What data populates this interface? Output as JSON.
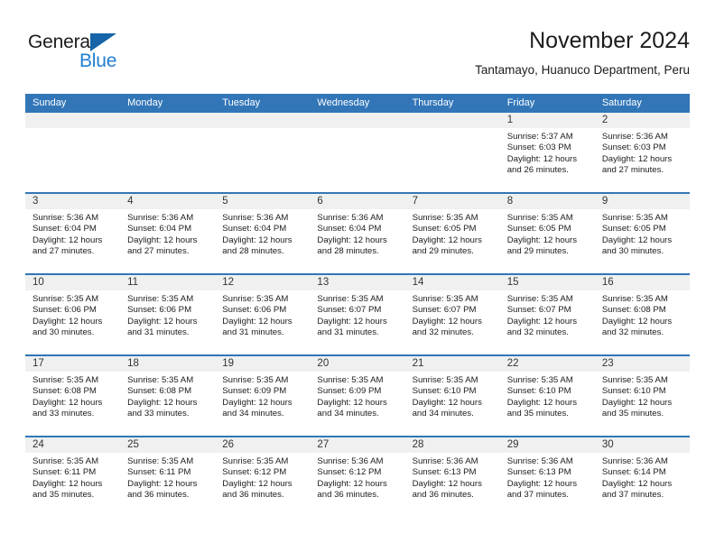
{
  "brand": {
    "word_one": "General",
    "word_two": "Blue",
    "accent_color": "#1f7fd1",
    "triangle_color": "#1565a8",
    "triangle_icon": "triangle-icon"
  },
  "header": {
    "title": "November 2024",
    "subtitle": "Tantamayo, Huanuco Department, Peru"
  },
  "calendar": {
    "header_bg": "#3276b8",
    "weekdays": [
      "Sunday",
      "Monday",
      "Tuesday",
      "Wednesday",
      "Thursday",
      "Friday",
      "Saturday"
    ],
    "weeks": [
      [
        {
          "day": "",
          "sunrise": "",
          "sunset": "",
          "daylight": ""
        },
        {
          "day": "",
          "sunrise": "",
          "sunset": "",
          "daylight": ""
        },
        {
          "day": "",
          "sunrise": "",
          "sunset": "",
          "daylight": ""
        },
        {
          "day": "",
          "sunrise": "",
          "sunset": "",
          "daylight": ""
        },
        {
          "day": "",
          "sunrise": "",
          "sunset": "",
          "daylight": ""
        },
        {
          "day": "1",
          "sunrise": "Sunrise: 5:37 AM",
          "sunset": "Sunset: 6:03 PM",
          "daylight": "Daylight: 12 hours and 26 minutes."
        },
        {
          "day": "2",
          "sunrise": "Sunrise: 5:36 AM",
          "sunset": "Sunset: 6:03 PM",
          "daylight": "Daylight: 12 hours and 27 minutes."
        }
      ],
      [
        {
          "day": "3",
          "sunrise": "Sunrise: 5:36 AM",
          "sunset": "Sunset: 6:04 PM",
          "daylight": "Daylight: 12 hours and 27 minutes."
        },
        {
          "day": "4",
          "sunrise": "Sunrise: 5:36 AM",
          "sunset": "Sunset: 6:04 PM",
          "daylight": "Daylight: 12 hours and 27 minutes."
        },
        {
          "day": "5",
          "sunrise": "Sunrise: 5:36 AM",
          "sunset": "Sunset: 6:04 PM",
          "daylight": "Daylight: 12 hours and 28 minutes."
        },
        {
          "day": "6",
          "sunrise": "Sunrise: 5:36 AM",
          "sunset": "Sunset: 6:04 PM",
          "daylight": "Daylight: 12 hours and 28 minutes."
        },
        {
          "day": "7",
          "sunrise": "Sunrise: 5:35 AM",
          "sunset": "Sunset: 6:05 PM",
          "daylight": "Daylight: 12 hours and 29 minutes."
        },
        {
          "day": "8",
          "sunrise": "Sunrise: 5:35 AM",
          "sunset": "Sunset: 6:05 PM",
          "daylight": "Daylight: 12 hours and 29 minutes."
        },
        {
          "day": "9",
          "sunrise": "Sunrise: 5:35 AM",
          "sunset": "Sunset: 6:05 PM",
          "daylight": "Daylight: 12 hours and 30 minutes."
        }
      ],
      [
        {
          "day": "10",
          "sunrise": "Sunrise: 5:35 AM",
          "sunset": "Sunset: 6:06 PM",
          "daylight": "Daylight: 12 hours and 30 minutes."
        },
        {
          "day": "11",
          "sunrise": "Sunrise: 5:35 AM",
          "sunset": "Sunset: 6:06 PM",
          "daylight": "Daylight: 12 hours and 31 minutes."
        },
        {
          "day": "12",
          "sunrise": "Sunrise: 5:35 AM",
          "sunset": "Sunset: 6:06 PM",
          "daylight": "Daylight: 12 hours and 31 minutes."
        },
        {
          "day": "13",
          "sunrise": "Sunrise: 5:35 AM",
          "sunset": "Sunset: 6:07 PM",
          "daylight": "Daylight: 12 hours and 31 minutes."
        },
        {
          "day": "14",
          "sunrise": "Sunrise: 5:35 AM",
          "sunset": "Sunset: 6:07 PM",
          "daylight": "Daylight: 12 hours and 32 minutes."
        },
        {
          "day": "15",
          "sunrise": "Sunrise: 5:35 AM",
          "sunset": "Sunset: 6:07 PM",
          "daylight": "Daylight: 12 hours and 32 minutes."
        },
        {
          "day": "16",
          "sunrise": "Sunrise: 5:35 AM",
          "sunset": "Sunset: 6:08 PM",
          "daylight": "Daylight: 12 hours and 32 minutes."
        }
      ],
      [
        {
          "day": "17",
          "sunrise": "Sunrise: 5:35 AM",
          "sunset": "Sunset: 6:08 PM",
          "daylight": "Daylight: 12 hours and 33 minutes."
        },
        {
          "day": "18",
          "sunrise": "Sunrise: 5:35 AM",
          "sunset": "Sunset: 6:08 PM",
          "daylight": "Daylight: 12 hours and 33 minutes."
        },
        {
          "day": "19",
          "sunrise": "Sunrise: 5:35 AM",
          "sunset": "Sunset: 6:09 PM",
          "daylight": "Daylight: 12 hours and 34 minutes."
        },
        {
          "day": "20",
          "sunrise": "Sunrise: 5:35 AM",
          "sunset": "Sunset: 6:09 PM",
          "daylight": "Daylight: 12 hours and 34 minutes."
        },
        {
          "day": "21",
          "sunrise": "Sunrise: 5:35 AM",
          "sunset": "Sunset: 6:10 PM",
          "daylight": "Daylight: 12 hours and 34 minutes."
        },
        {
          "day": "22",
          "sunrise": "Sunrise: 5:35 AM",
          "sunset": "Sunset: 6:10 PM",
          "daylight": "Daylight: 12 hours and 35 minutes."
        },
        {
          "day": "23",
          "sunrise": "Sunrise: 5:35 AM",
          "sunset": "Sunset: 6:10 PM",
          "daylight": "Daylight: 12 hours and 35 minutes."
        }
      ],
      [
        {
          "day": "24",
          "sunrise": "Sunrise: 5:35 AM",
          "sunset": "Sunset: 6:11 PM",
          "daylight": "Daylight: 12 hours and 35 minutes."
        },
        {
          "day": "25",
          "sunrise": "Sunrise: 5:35 AM",
          "sunset": "Sunset: 6:11 PM",
          "daylight": "Daylight: 12 hours and 36 minutes."
        },
        {
          "day": "26",
          "sunrise": "Sunrise: 5:35 AM",
          "sunset": "Sunset: 6:12 PM",
          "daylight": "Daylight: 12 hours and 36 minutes."
        },
        {
          "day": "27",
          "sunrise": "Sunrise: 5:36 AM",
          "sunset": "Sunset: 6:12 PM",
          "daylight": "Daylight: 12 hours and 36 minutes."
        },
        {
          "day": "28",
          "sunrise": "Sunrise: 5:36 AM",
          "sunset": "Sunset: 6:13 PM",
          "daylight": "Daylight: 12 hours and 36 minutes."
        },
        {
          "day": "29",
          "sunrise": "Sunrise: 5:36 AM",
          "sunset": "Sunset: 6:13 PM",
          "daylight": "Daylight: 12 hours and 37 minutes."
        },
        {
          "day": "30",
          "sunrise": "Sunrise: 5:36 AM",
          "sunset": "Sunset: 6:14 PM",
          "daylight": "Daylight: 12 hours and 37 minutes."
        }
      ]
    ]
  }
}
